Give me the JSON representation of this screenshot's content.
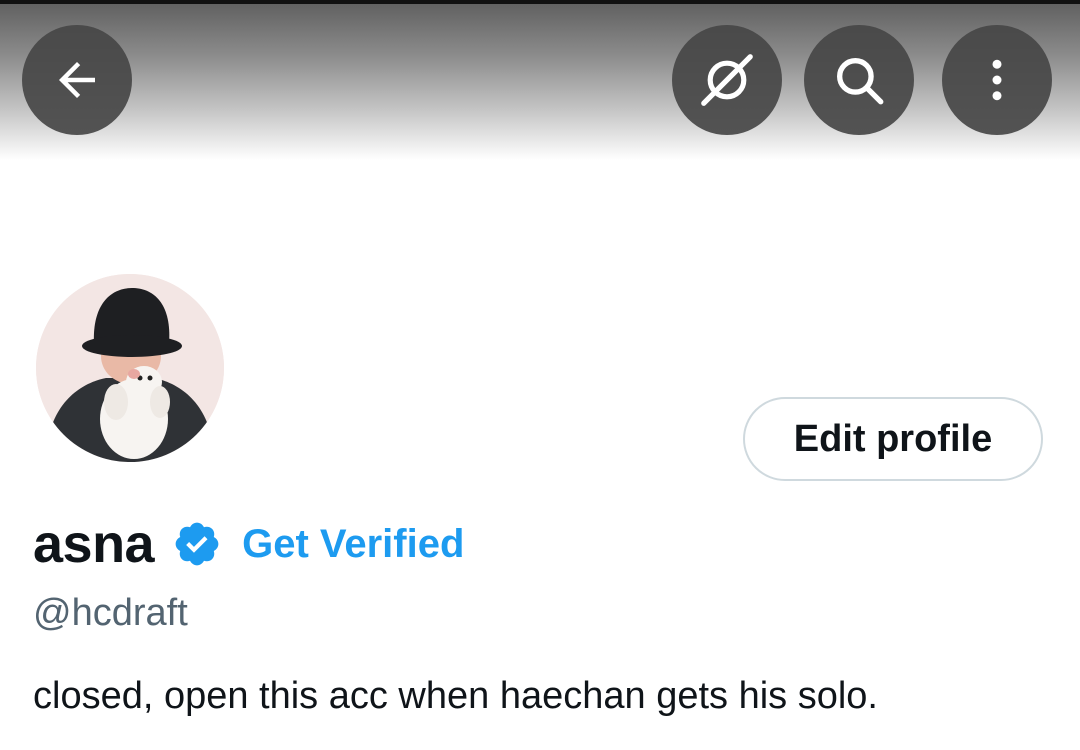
{
  "header": {
    "back_icon": "arrow-left-icon",
    "hide_icon": "eye-off-icon",
    "search_icon": "search-icon",
    "more_icon": "more-vertical-icon"
  },
  "profile": {
    "avatar_description": "avatar",
    "edit_button_label": "Edit profile",
    "display_name": "asna",
    "verified_badge_icon": "verified-badge-icon",
    "get_verified_label": "Get Verified",
    "handle": "@hcdraft",
    "bio": "closed, open this acc when haechan gets his solo."
  },
  "colors": {
    "accent": "#1d9bf0",
    "text_primary": "#0f1419",
    "text_secondary": "#536471",
    "button_border": "#cfd9de"
  }
}
